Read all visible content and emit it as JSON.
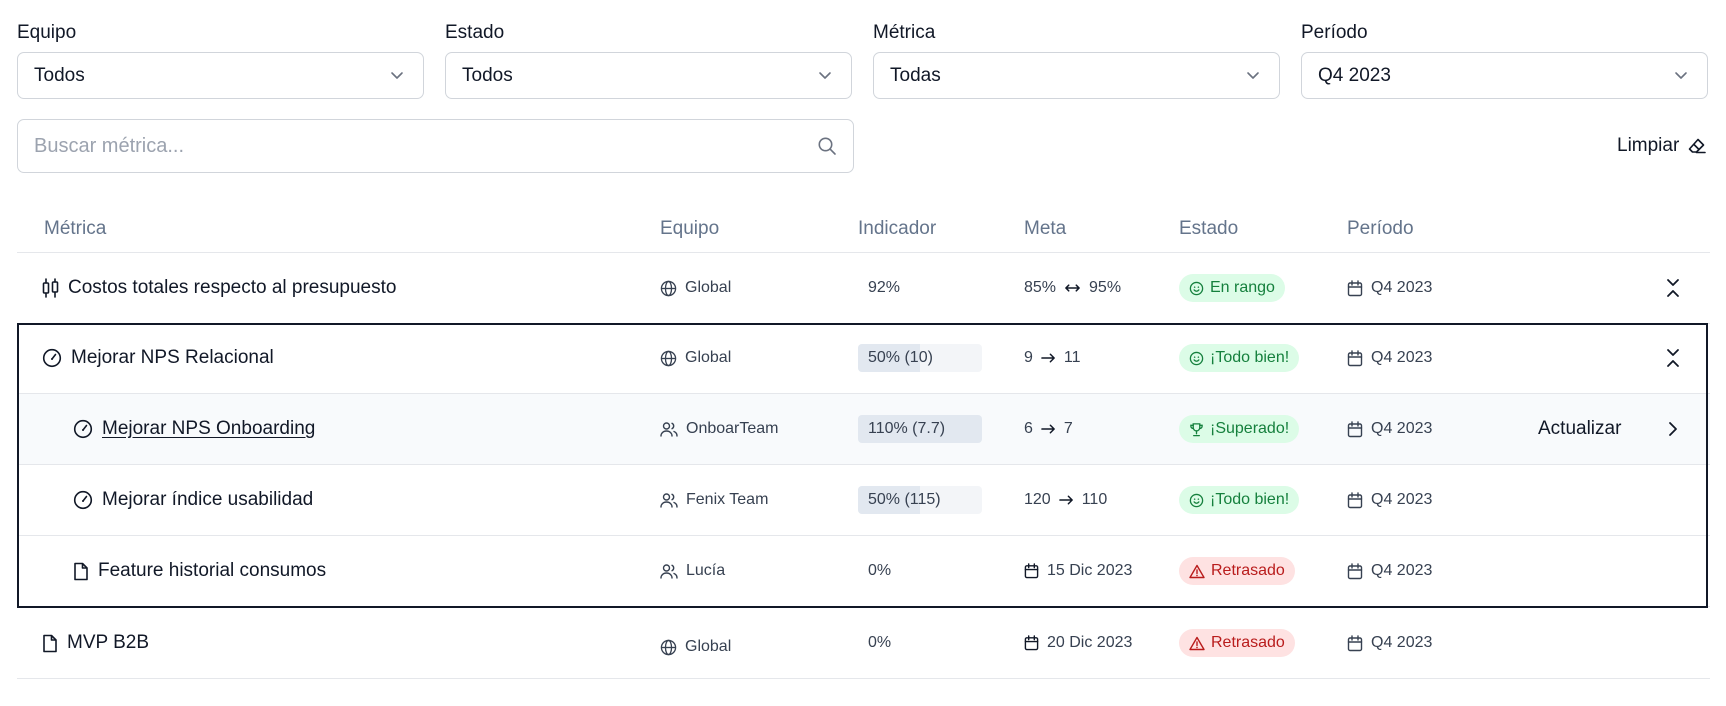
{
  "filters": [
    {
      "label": "Equipo",
      "value": "Todos"
    },
    {
      "label": "Estado",
      "value": "Todos"
    },
    {
      "label": "Métrica",
      "value": "Todas"
    },
    {
      "label": "Período",
      "value": "Q4 2023"
    }
  ],
  "search": {
    "placeholder": "Buscar métrica..."
  },
  "clear_label": "Limpiar",
  "columns": [
    "Métrica",
    "Equipo",
    "Indicador",
    "Meta",
    "Estado",
    "Período"
  ],
  "rows": [
    {
      "name": "Costos totales respecto al presupuesto",
      "team": "Global",
      "indicator": "92%",
      "meta_from": "85%",
      "meta_to": "95%",
      "status": "En rango",
      "period": "Q4 2023",
      "toggle": "collapse",
      "icons": {
        "metric": "candlestick-icon",
        "team": "globe-icon",
        "meta": "range-arrows-icon",
        "status": "smile-icon"
      }
    },
    {
      "name": "Mejorar NPS Relacional",
      "team": "Global",
      "indicator": "50% (10)",
      "progress": 0.5,
      "meta_from": "9",
      "meta_to": "11",
      "status": "¡Todo bien!",
      "period": "Q4 2023",
      "toggle": "collapse",
      "icons": {
        "metric": "gauge-icon",
        "team": "globe-icon",
        "meta": "arrow-right-icon",
        "status": "smile-icon"
      }
    },
    {
      "name": "Mejorar NPS Onboarding",
      "team": "OnboarTeam",
      "indicator": "110% (7.7)",
      "progress": 1.0,
      "meta_from": "6",
      "meta_to": "7",
      "status": "¡Superado!",
      "period": "Q4 2023",
      "action": "Actualizar",
      "icons": {
        "metric": "gauge-icon",
        "team": "users-icon",
        "meta": "arrow-right-icon",
        "status": "trophy-icon"
      }
    },
    {
      "name": "Mejorar índice usabilidad",
      "team": "Fenix Team",
      "indicator": "50% (115)",
      "progress": 0.5,
      "meta_from": "120",
      "meta_to": "110",
      "status": "¡Todo bien!",
      "period": "Q4 2023",
      "icons": {
        "metric": "gauge-icon",
        "team": "users-icon",
        "meta": "arrow-right-icon",
        "status": "smile-icon"
      }
    },
    {
      "name": "Feature historial consumos",
      "team": "Lucía",
      "indicator": "0%",
      "meta_date": "15 Dic 2023",
      "status": "Retrasado",
      "period": "Q4 2023",
      "icons": {
        "metric": "file-icon",
        "team": "users-icon",
        "meta": "calendar-icon",
        "status": "warning-icon"
      }
    },
    {
      "name": "MVP B2B",
      "team": "Global",
      "indicator": "0%",
      "meta_date": "20 Dic 2023",
      "status": "Retrasado",
      "period": "Q4 2023",
      "icons": {
        "metric": "file-icon",
        "team": "globe-icon",
        "meta": "calendar-icon",
        "status": "warning-icon"
      }
    }
  ],
  "colors": {
    "success_bg": "#dcfce7",
    "success_text": "#15803d",
    "danger_bg": "#fee2e2",
    "danger_text": "#b91c1c",
    "highlight_frame": "#111827"
  }
}
